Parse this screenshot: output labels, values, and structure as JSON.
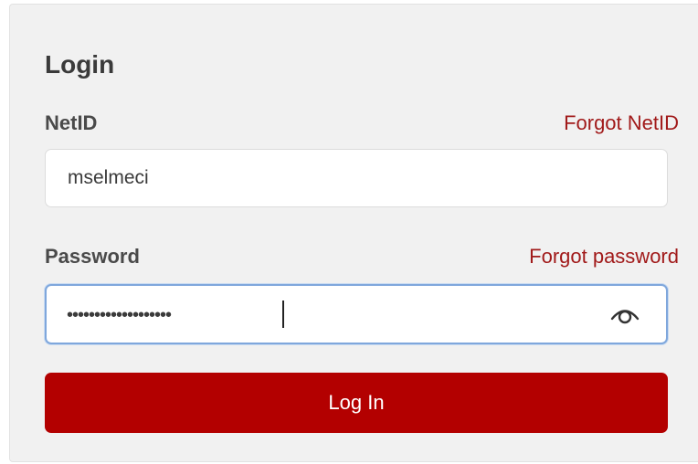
{
  "login_form": {
    "title": "Login",
    "netid": {
      "label": "NetID",
      "forgot_link": "Forgot NetID",
      "value": "mselmeci"
    },
    "password": {
      "label": "Password",
      "forgot_link": "Forgot password",
      "masked_value": "•••••••••••••••••••",
      "toggle_icon": "eye-icon"
    },
    "submit_label": "Log In"
  },
  "colors": {
    "accent": "#b30000",
    "link": "#a11a1a",
    "panel_background": "#f1f1f1",
    "focus_border": "#7fa7dc"
  }
}
